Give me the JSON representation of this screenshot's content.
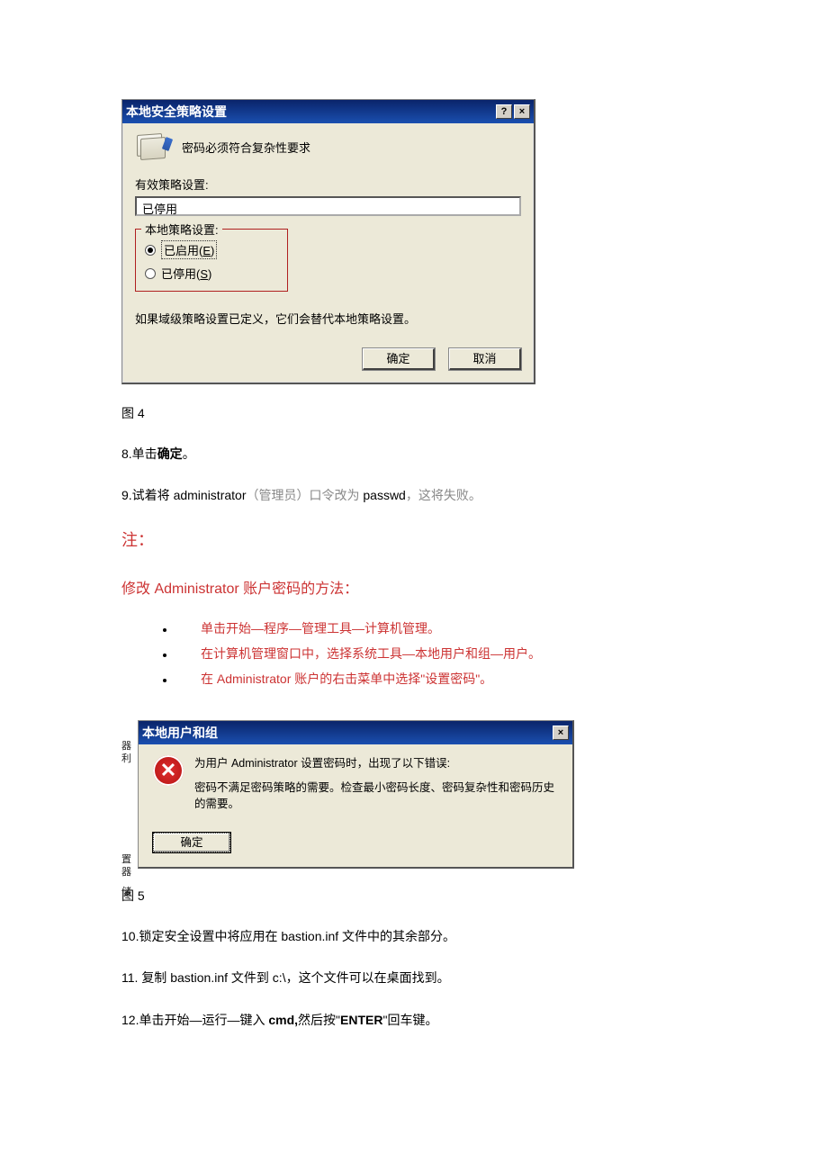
{
  "dialog1": {
    "title": "本地安全策略设置",
    "help_btn": "?",
    "close_btn": "×",
    "policy_label": "密码必须符合复杂性要求",
    "effective_label": "有效策略设置:",
    "effective_value": "已停用",
    "local_label": "本地策略设置:",
    "radio_enabled": "已启用",
    "radio_enabled_key": "E",
    "radio_disabled": "已停用",
    "radio_disabled_key": "S",
    "note": "如果域级策略设置已定义，它们会替代本地策略设置。",
    "ok": "确定",
    "cancel": "取消"
  },
  "fig4": "图 4",
  "step8_pre": "8.单击",
  "step8_bold": "确定",
  "step8_post": "。",
  "step9_a": "9.试着将 administrator",
  "step9_b": "（管理员）口令改为 ",
  "step9_c": "passwd",
  "step9_d": "，这将失败。",
  "note_heading": "注：",
  "method_heading": "修改 Administrator 账户密码的方法：",
  "bullets": [
    "单击开始—程序—管理工具—计算机管理。",
    "在计算机管理窗口中，选择系统工具—本地用户和组—用户。",
    "在 Administrator 账户的右击菜单中选择\"设置密码\"。"
  ],
  "dialog2": {
    "title": "本地用户和组",
    "close_btn": "×",
    "line1": "为用户 Administrator 设置密码时，出现了以下错误:",
    "line2": "密码不满足密码策略的需要。检查最小密码长度、密码复杂性和密码历史的需要。",
    "ok": "确定"
  },
  "fig5": "图 5",
  "step10": "10.锁定安全设置中将应用在 bastion.inf 文件中的其余部分。",
  "step11": "11. 复制 bastion.inf 文件到 c:\\，这个文件可以在桌面找到。",
  "step12_a": "12.单击开始—运行—键入 ",
  "step12_b": "cmd,",
  "step12_c": "然后按\"",
  "step12_d": "ENTER",
  "step12_e": "\"回车键。",
  "frags": {
    "left1a": "器",
    "left1b": "利",
    "left2a": "置",
    "left2b": "器",
    "left3": "储"
  }
}
